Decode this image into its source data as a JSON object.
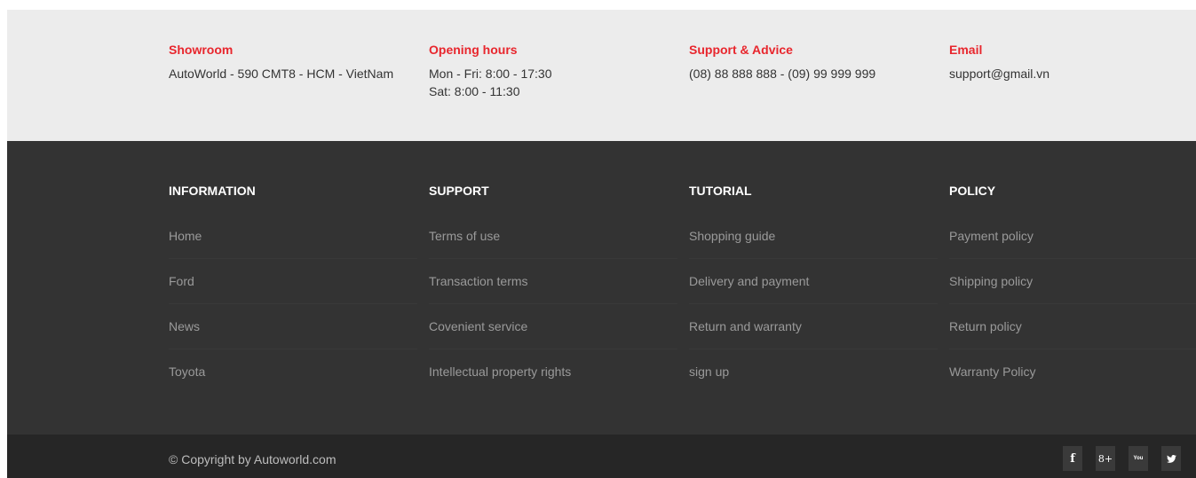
{
  "contact": {
    "showroom": {
      "title": "Showroom",
      "lines": [
        "AutoWorld - 590 CMT8 - HCM - VietNam"
      ]
    },
    "hours": {
      "title": "Opening hours",
      "lines": [
        "Mon - Fri: 8:00 - 17:30",
        "Sat: 8:00 - 11:30"
      ]
    },
    "support": {
      "title": "Support & Advice",
      "lines": [
        "(08) 88 888 888 - (09) 99 999 999"
      ]
    },
    "email": {
      "title": "Email",
      "lines": [
        "support@gmail.vn"
      ]
    }
  },
  "links": {
    "information": {
      "heading": "INFORMATION",
      "items": [
        "Home",
        "Ford",
        "News",
        "Toyota"
      ]
    },
    "support": {
      "heading": "SUPPORT",
      "items": [
        "Terms of use",
        "Transaction terms",
        "Covenient service",
        "Intellectual property rights"
      ]
    },
    "tutorial": {
      "heading": "TUTORIAL",
      "items": [
        "Shopping guide",
        "Delivery and payment",
        "Return and warranty",
        "sign up"
      ]
    },
    "policy": {
      "heading": "POLICY",
      "items": [
        "Payment policy",
        "Shipping policy",
        "Return policy",
        "Warranty Policy"
      ]
    }
  },
  "footer": {
    "copyright": "© Copyright by Autoworld.com",
    "socials": [
      {
        "icon": "facebook-icon",
        "glyph": "f"
      },
      {
        "icon": "google-plus-icon",
        "glyph": "8+"
      },
      {
        "icon": "youtube-icon",
        "glyph": "You"
      },
      {
        "icon": "twitter-icon",
        "glyph": ""
      }
    ]
  },
  "colors": {
    "accent": "#e8262d",
    "contact_bg": "#ececec",
    "links_bg": "#333333",
    "bottom_bg": "#262626"
  }
}
